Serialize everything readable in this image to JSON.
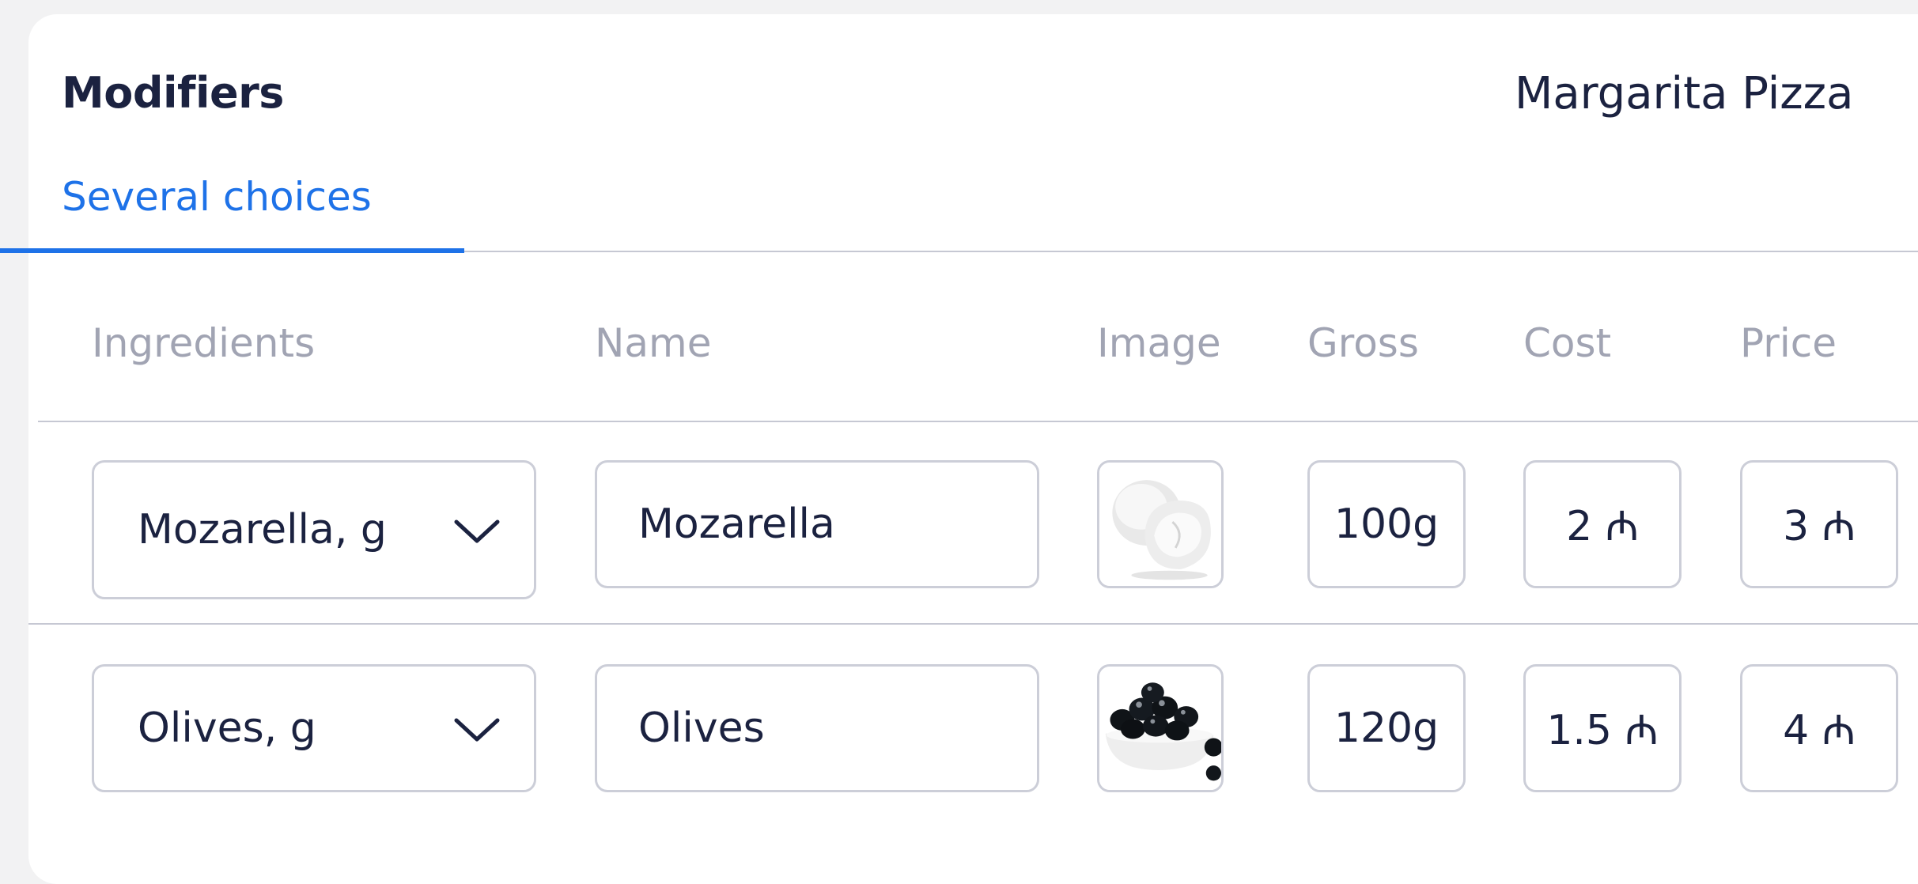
{
  "header": {
    "title": "Modifiers",
    "product": "Margarita Pizza"
  },
  "tabs": [
    {
      "label": "Several choices",
      "active": true
    }
  ],
  "columns": {
    "ingredients": "Ingredients",
    "name": "Name",
    "image": "Image",
    "gross": "Gross",
    "cost": "Cost",
    "price": "Price"
  },
  "rows": [
    {
      "ingredient": "Mozarella, g",
      "name": "Mozarella",
      "image_icon": "mozzarella-image",
      "gross": "100g",
      "cost": "2 ₼",
      "price": "3 ₼"
    },
    {
      "ingredient": "Olives, g",
      "name": "Olives",
      "image_icon": "olives-image",
      "gross": "120g",
      "cost": "1.5 ₼",
      "price": "4 ₼"
    }
  ],
  "colors": {
    "accent": "#1e72e8",
    "text": "#1b2240",
    "muted": "#a1a4b3",
    "border": "#ccced8"
  }
}
